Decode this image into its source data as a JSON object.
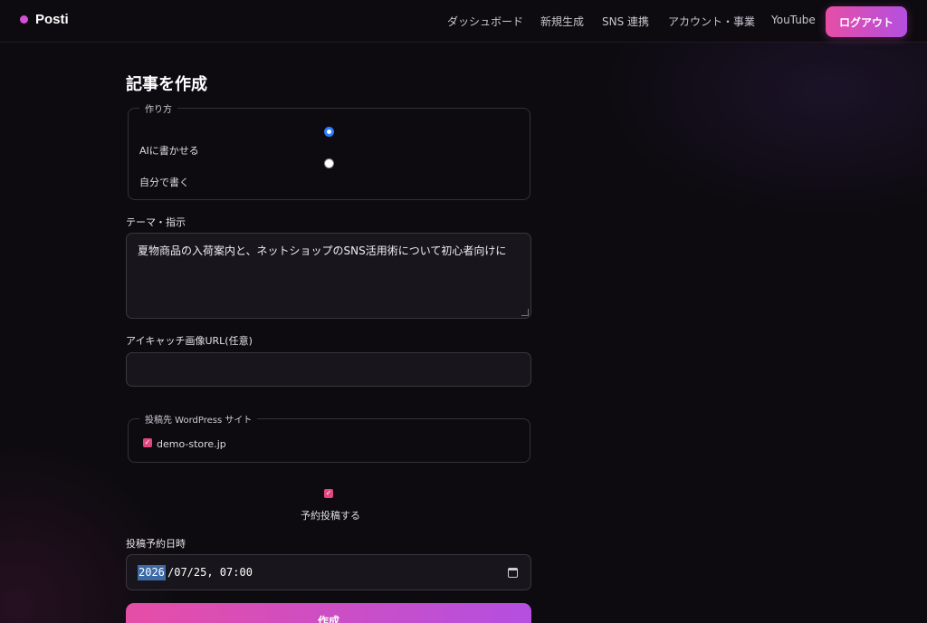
{
  "header": {
    "brand": "Posti",
    "nav": [
      "ダッシュボード",
      "新規生成",
      "SNS 連携",
      "アカウント・事業",
      "YouTube"
    ],
    "logout": "ログアウト",
    "accent": "#e64ea6"
  },
  "form": {
    "title": "記事を作成",
    "method": {
      "legend": "作り方",
      "options": [
        {
          "label": "AIに書かせる",
          "checked": true
        },
        {
          "label": "自分で書く",
          "checked": false
        }
      ]
    },
    "theme": {
      "label": "テーマ・指示",
      "value": "夏物商品の入荷案内と、ネットショップのSNS活用術について初心者向けに"
    },
    "image_url": {
      "label": "アイキャッチ画像URL(任意)",
      "value": ""
    },
    "wordpress": {
      "legend": "投稿先 WordPress サイト",
      "sites": [
        {
          "label": "demo-store.jp",
          "checked": true
        }
      ]
    },
    "schedule": {
      "label": "予約投稿する",
      "checked": true
    },
    "datetime": {
      "label": "投稿予約日時",
      "year": "2026",
      "rest": "/07/25, 07:00"
    },
    "submit": "作成"
  }
}
